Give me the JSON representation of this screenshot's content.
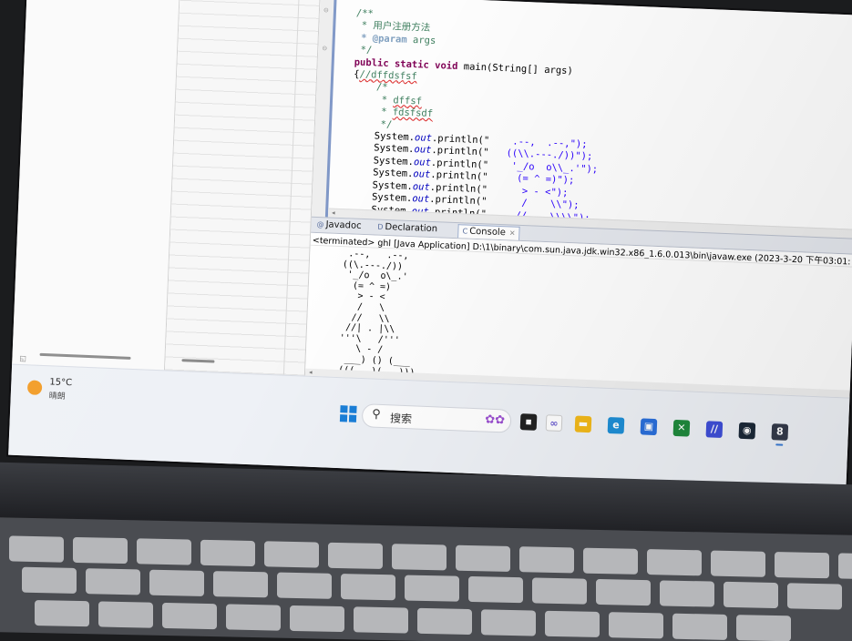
{
  "editor": {
    "lines": [
      {
        "kind": "comment",
        "text": "/**"
      },
      {
        "kind": "comment",
        "text": " * 用户注册方法"
      },
      {
        "kind": "param",
        "tag": " * @param",
        "rest": " args"
      },
      {
        "kind": "comment",
        "text": " */"
      },
      {
        "kind": "sig",
        "kw": "public static void",
        "rest": " main(String[] args)"
      },
      {
        "kind": "brace",
        "pre": "{",
        "text": "//dffdsfsf"
      },
      {
        "kind": "comment",
        "text": "    /*"
      },
      {
        "kind": "errc",
        "pre": "     * ",
        "text": "dffsf"
      },
      {
        "kind": "errc",
        "pre": "     * ",
        "text": "fdsfsdf"
      },
      {
        "kind": "comment",
        "text": "     */"
      },
      {
        "kind": "println",
        "arg": "    .--,  .--,\");"
      },
      {
        "kind": "println",
        "arg": "   ((\\\\.---./))\");"
      },
      {
        "kind": "println",
        "arg": "    '_/o  o\\\\_.'\");"
      },
      {
        "kind": "println",
        "arg": "     (= ^ =)\");"
      },
      {
        "kind": "println",
        "arg": "      > - <\");"
      },
      {
        "kind": "println",
        "arg": "      /    \\\\\");"
      },
      {
        "kind": "println",
        "arg": "     //    \\\\\\\\\");"
      }
    ],
    "println_prefix": "    System.",
    "println_field": "out",
    "println_call": ".println(\""
  },
  "console": {
    "tabs": [
      {
        "label": "Javadoc",
        "icon": "@"
      },
      {
        "label": "Declaration",
        "icon": "D"
      },
      {
        "label": "Console",
        "icon": "C",
        "active": true
      }
    ],
    "status": "<terminated> ghl [Java Application] D:\\1\\binary\\com.sun.java.jdk.win32.x86_1.6.0.013\\bin\\javaw.exe (2023-3-20 下午03:01:",
    "output": "  .--,   .--,\n ((\\.---./))\n  '_/o  o\\_.'\n   (= ^ =)\n    > - <\n    /   \\\n   //   \\\\\n  //| . |\\\\\n '''\\   /'''\n    \\ - /\n  ___) () (___\n (((   )(   )))"
  },
  "taskbar": {
    "temperature": "15°C",
    "condition": "晴朗",
    "search_placeholder": "搜索",
    "colors": {
      "accent": "#1a7fd8",
      "weather": "#f29b24"
    },
    "apps": [
      {
        "name": "file-explorer-icon",
        "color": "#f2b91a",
        "glyph": "▬"
      },
      {
        "name": "edge-icon",
        "color": "#1e8fd6",
        "glyph": "e"
      },
      {
        "name": "store-icon",
        "color": "#2a6fdb",
        "glyph": "▣"
      },
      {
        "name": "xbox-icon",
        "color": "#1f8a3c",
        "glyph": "✕"
      },
      {
        "name": "vscode-icon",
        "color": "#3f4fd8",
        "glyph": "//"
      },
      {
        "name": "steam-icon",
        "color": "#1b2838",
        "glyph": "◉"
      },
      {
        "name": "java-ide-icon",
        "color": "#333a4a",
        "glyph": "8"
      }
    ]
  }
}
